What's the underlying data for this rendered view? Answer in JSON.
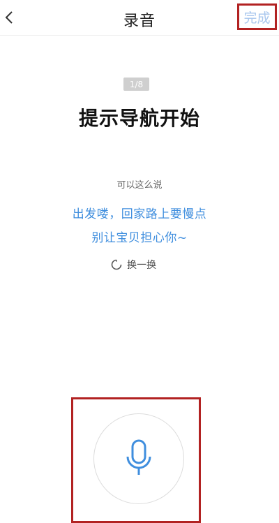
{
  "header": {
    "title": "录音",
    "done_label": "完成"
  },
  "step": {
    "counter": "1/8"
  },
  "prompt": {
    "title": "提示导航开始",
    "hint": "可以这么说",
    "suggestion_line1": "出发喽，回家路上要慢点",
    "suggestion_line2": "别让宝贝担心你~"
  },
  "refresh": {
    "label": "换一换",
    "icon": "refresh-icon"
  },
  "mic": {
    "icon": "microphone-icon"
  },
  "colors": {
    "accent_blue": "#3f8ede",
    "done_text": "#a9c7ee",
    "highlight_red": "#b22222",
    "badge_grey": "#cfcfcf"
  }
}
